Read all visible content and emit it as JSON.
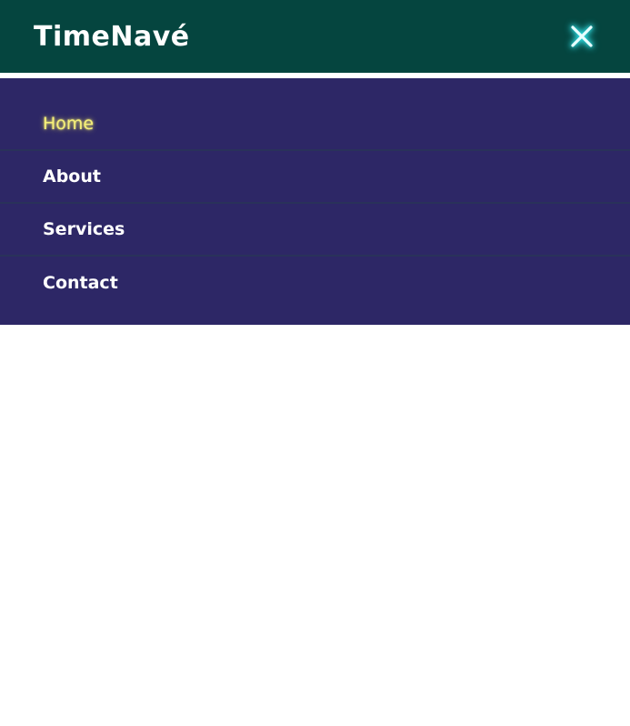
{
  "header": {
    "brand": "TimeNavé",
    "close_icon": "close-icon"
  },
  "menu": {
    "items": [
      {
        "label": "Home",
        "active": true
      },
      {
        "label": "About",
        "active": false
      },
      {
        "label": "Services",
        "active": false
      },
      {
        "label": "Contact",
        "active": false
      }
    ]
  },
  "colors": {
    "header_bg": "#05453f",
    "menu_bg": "#2d2766",
    "active_text": "#f6f07a",
    "close_glow": "#31e0e6"
  }
}
